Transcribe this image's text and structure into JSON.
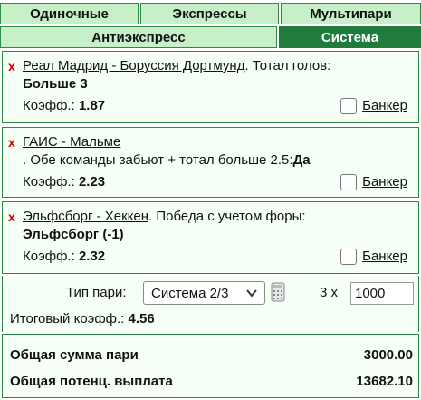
{
  "tabs": {
    "row1": [
      "Одиночные",
      "Экспрессы",
      "Мультипари"
    ],
    "row2": [
      "Антиэкспресс",
      "Система"
    ],
    "active": "Система"
  },
  "bets": [
    {
      "event": "Реал Мадрид - Боруссия Дортмунд",
      "market": ". Тотал голов:",
      "selection": "Больше 3",
      "coef_label": "Коэфф.:",
      "coef": "1.87",
      "banker_label": "Банкер"
    },
    {
      "event": "ГАИС - Мальме",
      "market": ". Обе команды забьют + тотал больше 2.5:",
      "selection": "Да",
      "coef_label": "Коэфф.:",
      "coef": "2.23",
      "banker_label": "Банкер"
    },
    {
      "event": "Эльфсборг - Хеккен",
      "market": ". Победа с учетом форы:",
      "selection": "Эльфсборг (-1)",
      "coef_label": "Коэфф.:",
      "coef": "2.32",
      "banker_label": "Банкер"
    }
  ],
  "remove_symbol": "x",
  "settings": {
    "bet_type_label": "Тип пари:",
    "bet_type_value": "Система 2/3",
    "multiplier": "3 x",
    "amount": "1000",
    "total_coef_label": "Итоговый коэфф.:",
    "total_coef": "4.56"
  },
  "totals": {
    "stake_label": "Общая сумма пари",
    "stake_value": "3000.00",
    "payout_label": "Общая потенц. выплата",
    "payout_value": "13682.10"
  },
  "colors": {
    "tab_active": "#1f7c3d",
    "tab_inactive": "#c8f0c8",
    "border": "#2a8a46",
    "remove": "#cc0000"
  },
  "icons": [
    "close-icon",
    "checkbox",
    "chevron-down-icon",
    "calculator-icon"
  ]
}
